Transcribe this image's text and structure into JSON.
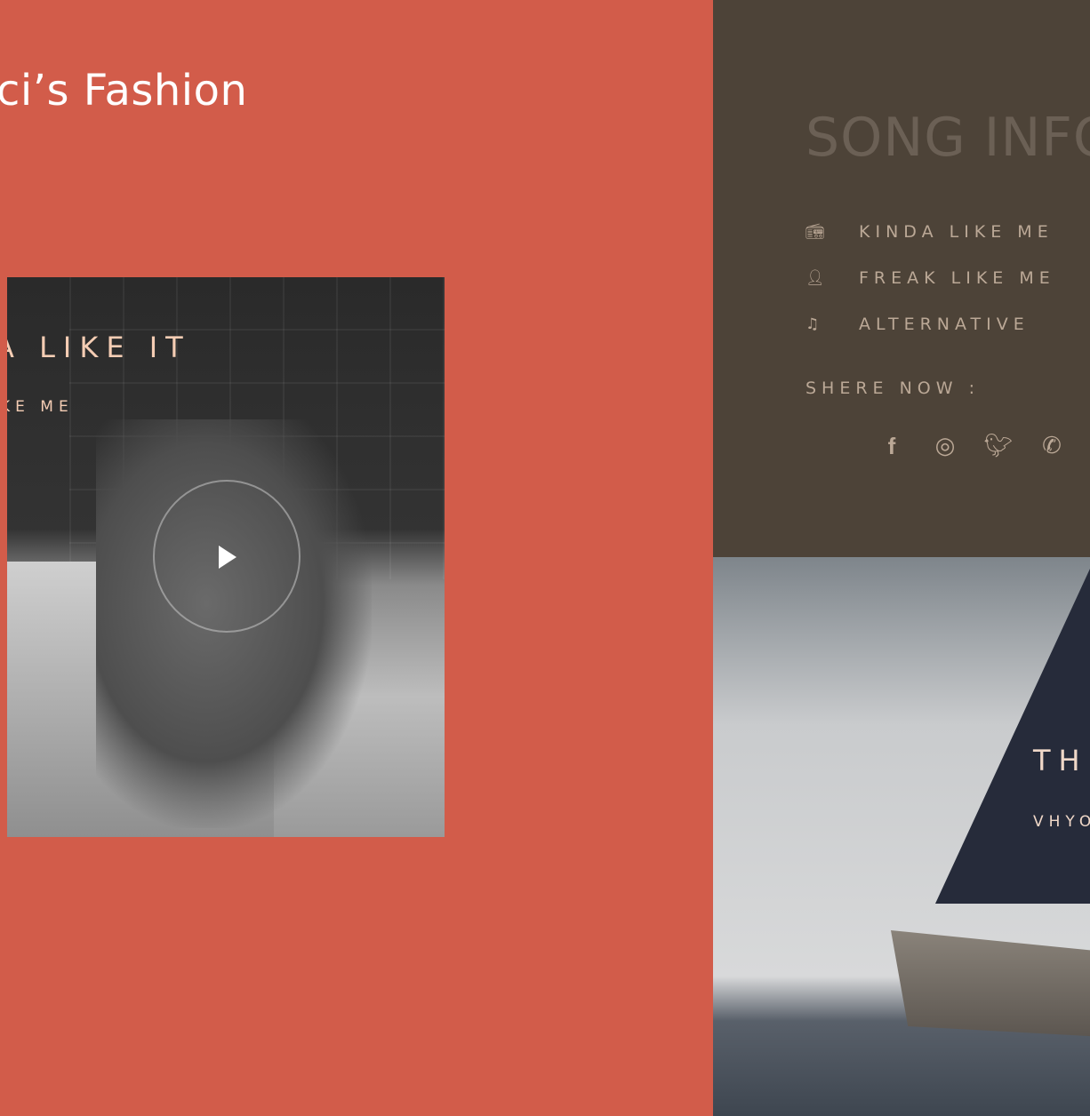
{
  "left": {
    "title": "ci’s Fashion",
    "card": {
      "title": "A LIKE IT",
      "subtitle": "KE ME",
      "play_icon": "play-icon"
    }
  },
  "song_info": {
    "heading": "SONG INFO",
    "items": [
      {
        "icon": "radio-icon",
        "label": "KINDA LIKE ME"
      },
      {
        "icon": "user-icon",
        "label": "FREAK LIKE ME"
      },
      {
        "icon": "music-icon",
        "label": "ALTERNATIVE"
      }
    ],
    "share_label": "SHERE NOW :",
    "social": [
      "facebook-icon",
      "instagram-icon",
      "twitter-icon",
      "whatsapp-icon"
    ]
  },
  "sea_card": {
    "title": "THE",
    "subtitle": "VHYO"
  },
  "colors": {
    "left_bg": "#d25c4a",
    "info_bg": "#4d4338",
    "text_light": "#bba896",
    "accent": "#f5cdb4"
  }
}
